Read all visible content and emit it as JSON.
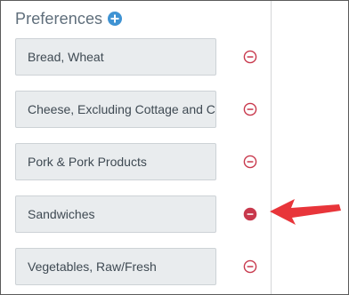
{
  "header": {
    "title": "Preferences",
    "add_icon": "plus-circle-icon",
    "add_icon_color": "#3f93d3"
  },
  "preferences": [
    {
      "label": "Bread, Wheat",
      "remove_icon": "minus-circle-outline-icon",
      "state": "default"
    },
    {
      "label": "Cheese, Excluding Cottage and Cream",
      "remove_icon": "minus-circle-outline-icon",
      "state": "default"
    },
    {
      "label": "Pork & Pork Products",
      "remove_icon": "minus-circle-outline-icon",
      "state": "default"
    },
    {
      "label": "Sandwiches",
      "remove_icon": "minus-circle-filled-icon",
      "state": "hover"
    },
    {
      "label": "Vegetables, Raw/Fresh",
      "remove_icon": "minus-circle-outline-icon",
      "state": "default"
    }
  ],
  "annotation": {
    "icon": "red-arrow-icon",
    "color": "#e8353a"
  },
  "colors": {
    "remove": "#c8384c",
    "item_background": "#e9ecee",
    "title_text": "#5f6e7b"
  }
}
